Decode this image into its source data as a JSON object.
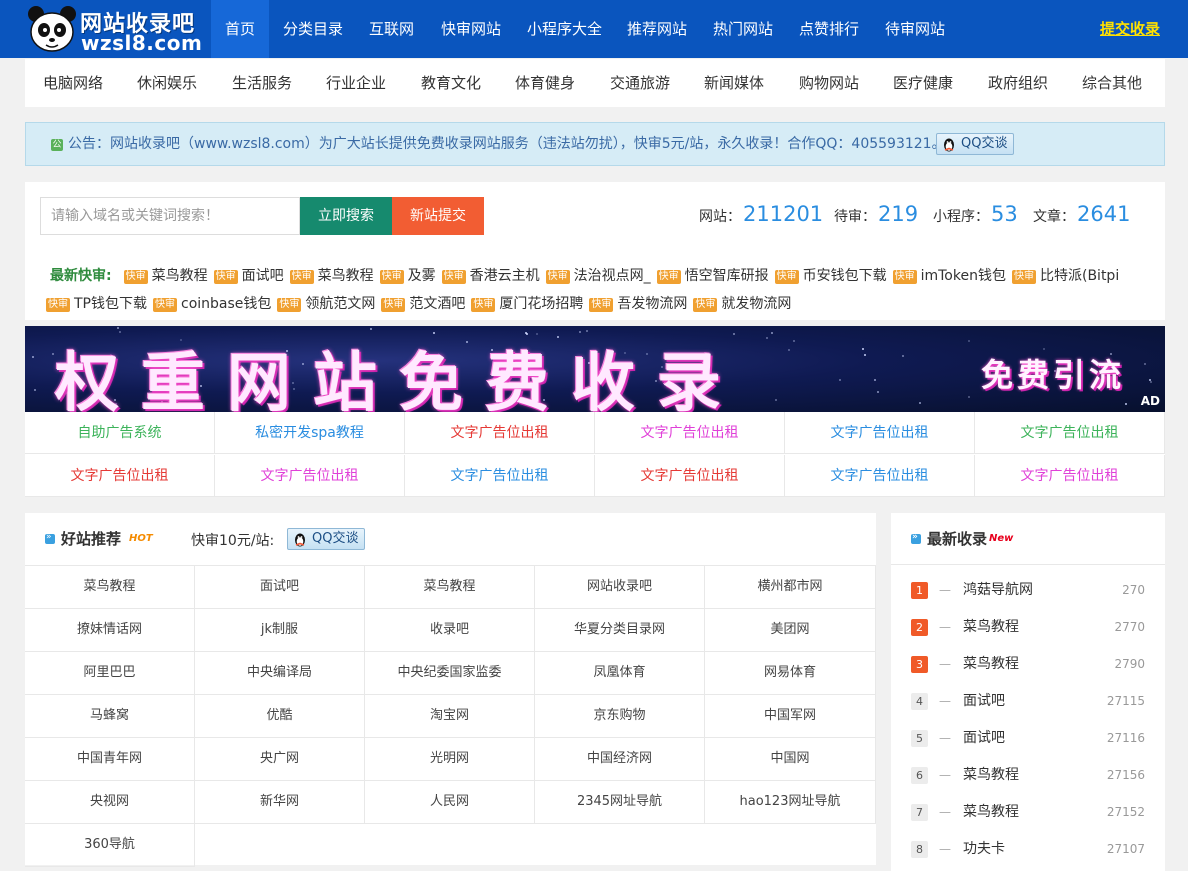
{
  "header": {
    "logo_cn": "网站收录吧",
    "logo_domain": "wzsl8.com",
    "nav": [
      "首页",
      "分类目录",
      "互联网",
      "快审网站",
      "小程序大全",
      "推荐网站",
      "热门网站",
      "点赞排行",
      "待审网站"
    ],
    "submit_label": "提交收录"
  },
  "categories": [
    "电脑网络",
    "休闲娱乐",
    "生活服务",
    "行业企业",
    "教育文化",
    "体育健身",
    "交通旅游",
    "新闻媒体",
    "购物网站",
    "医疗健康",
    "政府组织",
    "综合其他"
  ],
  "notice": {
    "icon_text": "公",
    "text": "公告：网站收录吧（www.wzsl8.com）为广大站长提供免费收录网站服务（违法站勿扰），快审5元/站，永久收录！合作QQ：405593121。",
    "qq_label": "QQ交谈"
  },
  "search": {
    "placeholder": "请输入域名或关键词搜索！",
    "search_btn": "立即搜索",
    "new_btn": "新站提交"
  },
  "stats": [
    {
      "label": "网站：",
      "value": "211201"
    },
    {
      "label": "待审：",
      "value": "219"
    },
    {
      "label": "小程序：",
      "value": "53"
    },
    {
      "label": "文章：",
      "value": "2641"
    }
  ],
  "latest_fast": {
    "label": "最新快审:",
    "tag": "快审",
    "items": [
      "菜鸟教程",
      "面试吧",
      "菜鸟教程",
      "及雾",
      "香港云主机",
      "法治视点网_",
      "悟空智库研报",
      "币安钱包下载",
      "imToken钱包",
      "比特派(Bitpi",
      "TP钱包下载",
      "coinbase钱包",
      "领航范文网",
      "范文酒吧",
      "厦门花场招聘",
      "吾发物流网",
      "就发物流网"
    ]
  },
  "banner": {
    "main_text": "权重网站免费收录",
    "side_text": "免费引流",
    "ad_label": "AD"
  },
  "ad_links": [
    {
      "text": "自助广告系统",
      "color": "#3cb35a"
    },
    {
      "text": "私密开发spa教程",
      "color": "#2a8de0"
    },
    {
      "text": "文字广告位出租",
      "color": "#e53935"
    },
    {
      "text": "文字广告位出租",
      "color": "#e040d8"
    },
    {
      "text": "文字广告位出租",
      "color": "#2a8de0"
    },
    {
      "text": "文字广告位出租",
      "color": "#3cb35a"
    },
    {
      "text": "文字广告位出租",
      "color": "#e53935"
    },
    {
      "text": "文字广告位出租",
      "color": "#e040d8"
    },
    {
      "text": "文字广告位出租",
      "color": "#2a8de0"
    },
    {
      "text": "文字广告位出租",
      "color": "#e53935"
    },
    {
      "text": "文字广告位出租",
      "color": "#2a8de0"
    },
    {
      "text": "文字广告位出租",
      "color": "#e040d8"
    }
  ],
  "recommend": {
    "title": "好站推荐",
    "hot": "HOT",
    "fast_text": "快审10元/站:",
    "qq_label": "QQ交谈",
    "sites": [
      "菜鸟教程",
      "面试吧",
      "菜鸟教程",
      "网站收录吧",
      "横州都市网",
      "撩妹情话网",
      "jk制服",
      "收录吧",
      "华夏分类目录网",
      "美团网",
      "阿里巴巴",
      "中央编译局",
      "中央纪委国家监委",
      "凤凰体育",
      "网易体育",
      "马蜂窝",
      "优酷",
      "淘宝网",
      "京东购物",
      "中国军网",
      "中国青年网",
      "央广网",
      "光明网",
      "中国经济网",
      "中国网",
      "央视网",
      "新华网",
      "人民网",
      "2345网址导航",
      "hao123网址导航",
      "360导航"
    ]
  },
  "newest": {
    "title": "最新收录",
    "new_tag": "New",
    "dash": "—",
    "items": [
      {
        "rank": "1",
        "name": "鸿菇导航网",
        "count": "270"
      },
      {
        "rank": "2",
        "name": "菜鸟教程",
        "count": "2770"
      },
      {
        "rank": "3",
        "name": "菜鸟教程",
        "count": "2790"
      },
      {
        "rank": "4",
        "name": "面试吧",
        "count": "27115"
      },
      {
        "rank": "5",
        "name": "面试吧",
        "count": "27116"
      },
      {
        "rank": "6",
        "name": "菜鸟教程",
        "count": "27156"
      },
      {
        "rank": "7",
        "name": "菜鸟教程",
        "count": "27152"
      },
      {
        "rank": "8",
        "name": "功夫卡",
        "count": "27107"
      }
    ]
  }
}
